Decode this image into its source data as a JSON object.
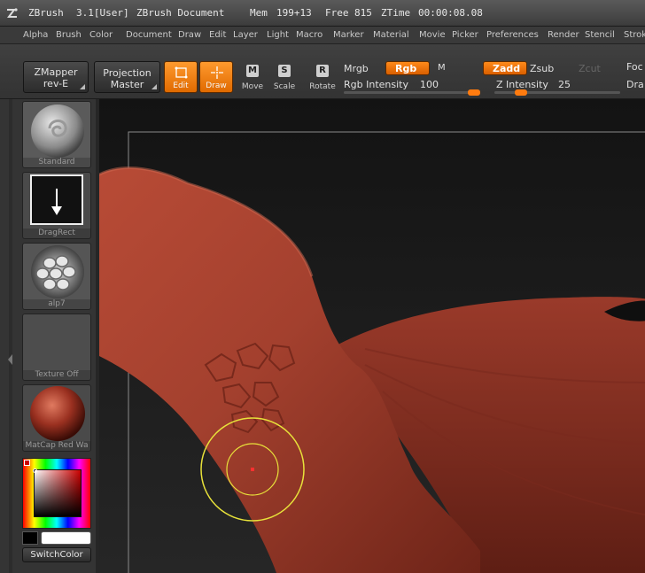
{
  "titlebar": {
    "app": "ZBrush",
    "version": "3.1[User]",
    "document": "ZBrush Document",
    "mem_label": "Mem",
    "mem_value": "199+13",
    "free_label": "Free",
    "free_value": "815",
    "ztime_label": "ZTime",
    "ztime_value": "00:00:08.08"
  },
  "menu": [
    "Alpha",
    "Brush",
    "Color",
    "Document",
    "Draw",
    "Edit",
    "Layer",
    "Light",
    "Macro",
    "Marker",
    "Material",
    "Movie",
    "Picker",
    "Preferences",
    "Render",
    "Stencil",
    "Strok"
  ],
  "toolbar": {
    "zmapper_l1": "ZMapper",
    "zmapper_l2": "rev-E",
    "projection_l1": "Projection",
    "projection_l2": "Master",
    "edit": "Edit",
    "draw": "Draw",
    "move": "Move",
    "move_key": "M",
    "scale": "Scale",
    "scale_key": "S",
    "rotate": "Rotate",
    "rotate_key": "R",
    "mrgb": "Mrgb",
    "rgb": "Rgb",
    "m": "M",
    "rgb_intensity_label": "Rgb Intensity",
    "rgb_intensity_value": "100",
    "zadd": "Zadd",
    "zsub": "Zsub",
    "zcut": "Zcut",
    "z_intensity_label": "Z Intensity",
    "z_intensity_value": "25",
    "focal": "Foc",
    "draw_size": "Dra"
  },
  "shelf": {
    "brush": "Standard",
    "stroke": "DragRect",
    "alpha": "alp7",
    "texture": "Texture Off",
    "material": "MatCap Red Wa",
    "switch_color": "SwitchColor"
  },
  "colors": {
    "accent": "#ff7b0f",
    "model": "#a3402e",
    "cursor": "#e8e23a"
  }
}
